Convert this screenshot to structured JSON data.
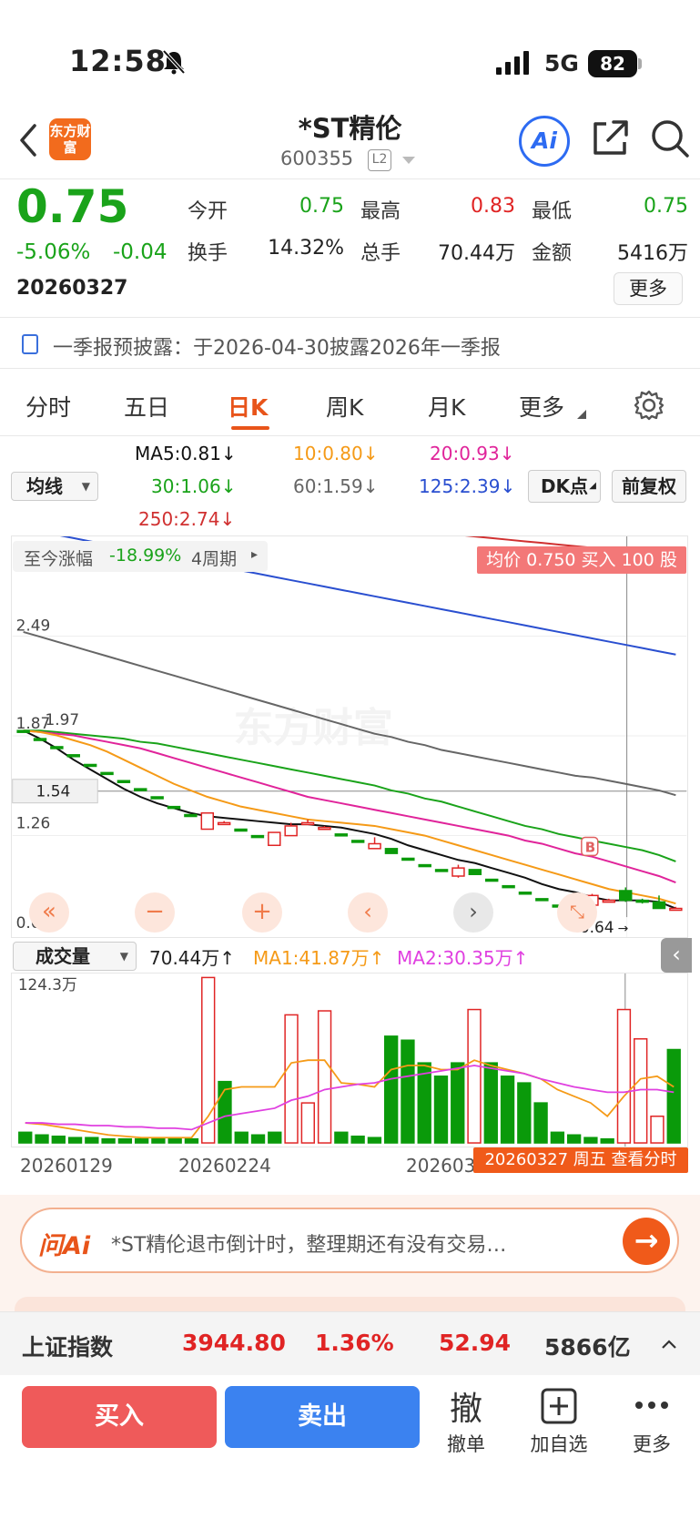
{
  "status": {
    "time": "12:58",
    "network": "5G",
    "battery": "82"
  },
  "header": {
    "logo_text": "东方财富",
    "stock_name": "*ST精伦",
    "stock_code": "600355",
    "level_badge": "L2"
  },
  "quote": {
    "price": "0.75",
    "change_pct": "-5.06%",
    "change_amt": "-0.04",
    "date": "20260327",
    "stats": [
      {
        "label": "今开",
        "value": "0.75",
        "color": "#1aa31a"
      },
      {
        "label": "最高",
        "value": "0.83",
        "color": "#e02424"
      },
      {
        "label": "最低",
        "value": "0.75",
        "color": "#1aa31a"
      },
      {
        "label": "换手",
        "value": "14.32%",
        "color": "#222222"
      },
      {
        "label": "总手",
        "value": "70.44万",
        "color": "#222222"
      },
      {
        "label": "金额",
        "value": "5416万",
        "color": "#222222"
      }
    ],
    "more_label": "更多"
  },
  "notice": {
    "text": "一季报预披露：于2026-04-30披露2026年一季报"
  },
  "tabs": [
    {
      "label": "分时"
    },
    {
      "label": "五日"
    },
    {
      "label": "日K"
    },
    {
      "label": "周K"
    },
    {
      "label": "月K"
    },
    {
      "label": "更多"
    }
  ],
  "ma_legend": {
    "select_label": "均线",
    "ma5": "MA5:0.81↓",
    "ma10": "10:0.80↓",
    "ma20": "20:0.93↓",
    "ma30": "30:1.06↓",
    "ma60": "60:1.59↓",
    "ma125": "125:2.39↓",
    "ma250": "250:2.74↓",
    "dk_label": "DK点",
    "fq_label": "前复权"
  },
  "kline": {
    "range_label": "至今涨幅",
    "range_value": "-18.99%",
    "range_period": "4周期",
    "avg_badge": "均价 0.750 买入 100 股",
    "price_labels": {
      "p249": "2.49",
      "p197": "1.97",
      "p187": "1.87",
      "p154": "1.54",
      "p126": "1.26",
      "p064": "0.64"
    },
    "last_label": "0.64",
    "marker_b": "B",
    "watermark": "东方财富",
    "colors": {
      "up": "#e02424",
      "down": "#0a9a0a",
      "ma5": "#111111",
      "ma10": "#f59a17",
      "ma20": "#e0249a",
      "ma30": "#1aa31a",
      "ma60": "#666666",
      "ma125": "#2a4fd0",
      "ma250": "#d03030"
    }
  },
  "volume": {
    "select_label": "成交量",
    "vol_legend": "70.44万↑",
    "ma1_legend": "MA1:41.87万↑",
    "ma2_legend": "MA2:30.35万↑",
    "max_label": "124.3万",
    "date_labels": [
      "20260129",
      "20260224",
      "202603"
    ],
    "cursor_tag": "20260327 周五 查看分时"
  },
  "ask": {
    "logo": "问Ai",
    "text": "*ST精伦退市倒计时，整理期还有没有交易…"
  },
  "index": {
    "name": "上证指数",
    "value": "3944.80",
    "pct": "1.36%",
    "change": "52.94",
    "amount": "5866亿"
  },
  "actions": {
    "buy": "买入",
    "sell": "卖出",
    "cancel_icon": "撤",
    "cancel_label": "撤单",
    "add_label": "加自选",
    "more_label": "更多"
  },
  "chart_data": {
    "type": "candlestick",
    "ylim": [
      0.64,
      2.74
    ],
    "candles": [
      {
        "o": 1.85,
        "h": 1.85,
        "l": 1.84,
        "c": 1.84
      },
      {
        "o": 1.8,
        "h": 1.8,
        "l": 1.79,
        "c": 1.79
      },
      {
        "o": 1.75,
        "h": 1.75,
        "l": 1.74,
        "c": 1.74
      },
      {
        "o": 1.7,
        "h": 1.7,
        "l": 1.69,
        "c": 1.69
      },
      {
        "o": 1.64,
        "h": 1.64,
        "l": 1.63,
        "c": 1.63
      },
      {
        "o": 1.59,
        "h": 1.59,
        "l": 1.58,
        "c": 1.58
      },
      {
        "o": 1.54,
        "h": 1.54,
        "l": 1.53,
        "c": 1.53
      },
      {
        "o": 1.49,
        "h": 1.49,
        "l": 1.48,
        "c": 1.48
      },
      {
        "o": 1.44,
        "h": 1.44,
        "l": 1.43,
        "c": 1.43
      },
      {
        "o": 1.38,
        "h": 1.38,
        "l": 1.37,
        "c": 1.37
      },
      {
        "o": 1.33,
        "h": 1.33,
        "l": 1.32,
        "c": 1.32
      },
      {
        "o": 1.24,
        "h": 1.34,
        "l": 1.24,
        "c": 1.34
      },
      {
        "o": 1.28,
        "h": 1.29,
        "l": 1.27,
        "c": 1.28
      },
      {
        "o": 1.24,
        "h": 1.24,
        "l": 1.23,
        "c": 1.23
      },
      {
        "o": 1.2,
        "h": 1.2,
        "l": 1.19,
        "c": 1.19
      },
      {
        "o": 1.14,
        "h": 1.22,
        "l": 1.14,
        "c": 1.22
      },
      {
        "o": 1.2,
        "h": 1.28,
        "l": 1.2,
        "c": 1.26
      },
      {
        "o": 1.28,
        "h": 1.3,
        "l": 1.27,
        "c": 1.28
      },
      {
        "o": 1.25,
        "h": 1.26,
        "l": 1.24,
        "c": 1.25
      },
      {
        "o": 1.21,
        "h": 1.21,
        "l": 1.2,
        "c": 1.2
      },
      {
        "o": 1.17,
        "h": 1.17,
        "l": 1.16,
        "c": 1.16
      },
      {
        "o": 1.12,
        "h": 1.19,
        "l": 1.12,
        "c": 1.15
      },
      {
        "o": 1.12,
        "h": 1.12,
        "l": 1.09,
        "c": 1.09
      },
      {
        "o": 1.06,
        "h": 1.06,
        "l": 1.05,
        "c": 1.05
      },
      {
        "o": 1.02,
        "h": 1.02,
        "l": 1.01,
        "c": 1.01
      },
      {
        "o": 0.99,
        "h": 0.99,
        "l": 0.98,
        "c": 0.98
      },
      {
        "o": 0.95,
        "h": 1.02,
        "l": 0.94,
        "c": 1.0
      },
      {
        "o": 0.99,
        "h": 0.99,
        "l": 0.96,
        "c": 0.96
      },
      {
        "o": 0.93,
        "h": 0.93,
        "l": 0.92,
        "c": 0.92
      },
      {
        "o": 0.89,
        "h": 0.89,
        "l": 0.88,
        "c": 0.88
      },
      {
        "o": 0.85,
        "h": 0.85,
        "l": 0.84,
        "c": 0.84
      },
      {
        "o": 0.81,
        "h": 0.81,
        "l": 0.8,
        "c": 0.8
      },
      {
        "o": 0.77,
        "h": 0.77,
        "l": 0.76,
        "c": 0.76
      },
      {
        "o": 0.73,
        "h": 0.8,
        "l": 0.73,
        "c": 0.79
      },
      {
        "o": 0.77,
        "h": 0.84,
        "l": 0.76,
        "c": 0.83
      },
      {
        "o": 0.8,
        "h": 0.81,
        "l": 0.79,
        "c": 0.8
      },
      {
        "o": 0.86,
        "h": 0.88,
        "l": 0.79,
        "c": 0.8
      },
      {
        "o": 0.8,
        "h": 0.81,
        "l": 0.78,
        "c": 0.79
      },
      {
        "o": 0.79,
        "h": 0.83,
        "l": 0.75,
        "c": 0.75
      },
      {
        "o": 0.75,
        "h": 0.76,
        "l": 0.74,
        "c": 0.75
      }
    ],
    "ma5": [
      1.85,
      1.8,
      1.74,
      1.67,
      1.61,
      1.55,
      1.49,
      1.44,
      1.4,
      1.37,
      1.34,
      1.32,
      1.31,
      1.3,
      1.29,
      1.28,
      1.27,
      1.27,
      1.26,
      1.25,
      1.23,
      1.21,
      1.18,
      1.14,
      1.11,
      1.08,
      1.05,
      1.03,
      1.0,
      0.97,
      0.94,
      0.9,
      0.87,
      0.85,
      0.82,
      0.8,
      0.8,
      0.8,
      0.79,
      0.75
    ],
    "ma10": [
      1.85,
      1.84,
      1.82,
      1.79,
      1.76,
      1.72,
      1.67,
      1.62,
      1.57,
      1.52,
      1.48,
      1.44,
      1.41,
      1.38,
      1.36,
      1.34,
      1.32,
      1.3,
      1.29,
      1.28,
      1.27,
      1.26,
      1.24,
      1.22,
      1.2,
      1.17,
      1.14,
      1.11,
      1.08,
      1.05,
      1.02,
      0.99,
      0.96,
      0.93,
      0.9,
      0.87,
      0.85,
      0.83,
      0.81,
      0.78
    ],
    "ma20": [
      1.85,
      1.84,
      1.83,
      1.82,
      1.8,
      1.78,
      1.76,
      1.74,
      1.71,
      1.68,
      1.65,
      1.62,
      1.59,
      1.56,
      1.53,
      1.5,
      1.47,
      1.44,
      1.42,
      1.4,
      1.38,
      1.36,
      1.34,
      1.32,
      1.3,
      1.28,
      1.26,
      1.24,
      1.22,
      1.2,
      1.17,
      1.15,
      1.12,
      1.09,
      1.07,
      1.04,
      1.01,
      0.98,
      0.95,
      0.91
    ],
    "ma30": [
      1.85,
      1.85,
      1.84,
      1.83,
      1.82,
      1.81,
      1.8,
      1.78,
      1.77,
      1.75,
      1.73,
      1.71,
      1.69,
      1.67,
      1.65,
      1.63,
      1.61,
      1.59,
      1.57,
      1.55,
      1.53,
      1.51,
      1.48,
      1.46,
      1.43,
      1.41,
      1.38,
      1.35,
      1.32,
      1.29,
      1.26,
      1.24,
      1.21,
      1.19,
      1.17,
      1.15,
      1.13,
      1.11,
      1.08,
      1.04
    ],
    "ma60": [
      2.46,
      2.43,
      2.4,
      2.37,
      2.34,
      2.31,
      2.28,
      2.25,
      2.22,
      2.19,
      2.16,
      2.13,
      2.1,
      2.07,
      2.04,
      2.01,
      1.98,
      1.95,
      1.92,
      1.89,
      1.86,
      1.83,
      1.81,
      1.78,
      1.76,
      1.73,
      1.71,
      1.69,
      1.67,
      1.65,
      1.63,
      1.61,
      1.59,
      1.57,
      1.56,
      1.54,
      1.52,
      1.5,
      1.48,
      1.45
    ],
    "ma125": [
      3.1,
      3.08,
      3.06,
      3.04,
      3.02,
      3.0,
      2.98,
      2.96,
      2.94,
      2.92,
      2.9,
      2.88,
      2.86,
      2.84,
      2.82,
      2.8,
      2.78,
      2.76,
      2.74,
      2.72,
      2.7,
      2.68,
      2.66,
      2.64,
      2.62,
      2.6,
      2.58,
      2.56,
      2.54,
      2.52,
      2.5,
      2.48,
      2.46,
      2.44,
      2.42,
      2.4,
      2.38,
      2.36,
      2.34,
      2.32
    ],
    "ma250": [
      3.35,
      3.34,
      3.33,
      3.32,
      3.31,
      3.3,
      3.29,
      3.28,
      3.27,
      3.26,
      3.25,
      3.24,
      3.23,
      3.22,
      3.21,
      3.2,
      3.19,
      3.18,
      3.17,
      3.16,
      3.15,
      3.14,
      3.12,
      3.11,
      3.09,
      3.08,
      3.06,
      3.05,
      3.04,
      3.03,
      3.02,
      3.01,
      3.0,
      2.99,
      2.98,
      2.97,
      2.96,
      2.95,
      2.94,
      2.93
    ],
    "volume_unit": "万",
    "volume_max": 124.3,
    "volumes": [
      8,
      6,
      5,
      4,
      4,
      3,
      3,
      3,
      3,
      3,
      3,
      124,
      46,
      8,
      6,
      8,
      96,
      30,
      99,
      8,
      5,
      4,
      80,
      77,
      60,
      50,
      60,
      100,
      60,
      50,
      45,
      30,
      8,
      6,
      4,
      3,
      100,
      78,
      20,
      70
    ],
    "vol_up": [
      false,
      false,
      false,
      false,
      false,
      false,
      false,
      false,
      false,
      false,
      false,
      true,
      false,
      false,
      false,
      false,
      true,
      true,
      true,
      false,
      false,
      false,
      false,
      false,
      false,
      false,
      false,
      true,
      false,
      false,
      false,
      false,
      false,
      false,
      false,
      false,
      true,
      true,
      true,
      false
    ],
    "vol_ma1": [
      15,
      14,
      12,
      10,
      8,
      6,
      5,
      4,
      4,
      4,
      4,
      20,
      40,
      42,
      42,
      42,
      60,
      62,
      62,
      45,
      44,
      42,
      55,
      58,
      58,
      55,
      55,
      62,
      58,
      55,
      52,
      48,
      40,
      35,
      30,
      20,
      35,
      48,
      50,
      42
    ],
    "vol_ma2": [
      15,
      15,
      14,
      14,
      13,
      13,
      12,
      12,
      11,
      11,
      10,
      15,
      20,
      22,
      24,
      26,
      32,
      35,
      40,
      42,
      44,
      45,
      48,
      50,
      52,
      54,
      56,
      58,
      56,
      54,
      52,
      48,
      45,
      42,
      40,
      38,
      38,
      40,
      40,
      38
    ]
  }
}
